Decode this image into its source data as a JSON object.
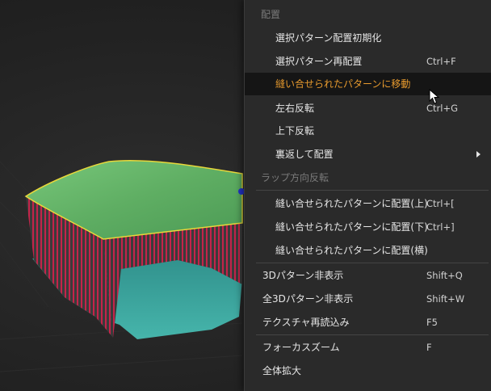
{
  "menu": {
    "header_arrange": "配置",
    "init_selected": "選択パターン配置初期化",
    "reposition_selected": {
      "label": "選択パターン再配置",
      "shortcut": "Ctrl+F"
    },
    "move_to_sewn": "縫い合せられたパターンに移動",
    "flip_horizontal": {
      "label": "左右反転",
      "shortcut": "Ctrl+G"
    },
    "flip_vertical": "上下反転",
    "flip_and_arrange": "裏返して配置",
    "header_wrap": "ラップ方向反転",
    "arrange_sewn_top": {
      "label": "縫い合せられたパターンに配置(上)",
      "shortcut": "Ctrl+["
    },
    "arrange_sewn_bottom": {
      "label": "縫い合せられたパターンに配置(下)",
      "shortcut": "Ctrl+]"
    },
    "arrange_sewn_side": "縫い合せられたパターンに配置(横)",
    "hide_3d_pattern": {
      "label": "3Dパターン非表示",
      "shortcut": "Shift+Q"
    },
    "hide_all_3d": {
      "label": "全3Dパターン非表示",
      "shortcut": "Shift+W"
    },
    "reload_texture": {
      "label": "テクスチャ再読込み",
      "shortcut": "F5"
    },
    "focus_zoom": {
      "label": "フォーカスズーム",
      "shortcut": "F"
    },
    "zoom_all": "全体拡大"
  },
  "colors": {
    "highlight_text": "#e79a2e",
    "pillow_top": "#6fc06a",
    "pillow_bottom": "#3fa9a0",
    "seam_lines": "#d02a4a"
  }
}
